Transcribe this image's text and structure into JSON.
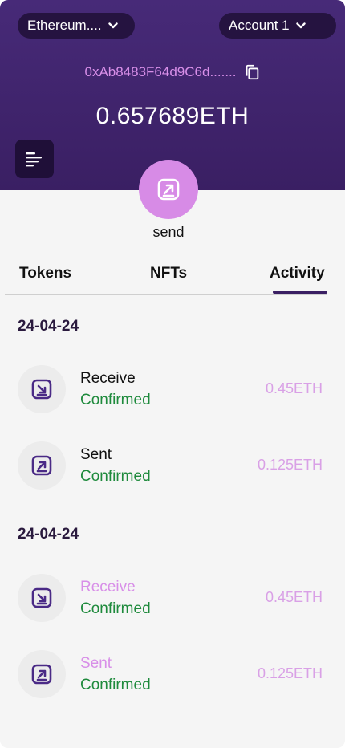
{
  "header": {
    "network_label": "Ethereum....",
    "account_label": "Account 1",
    "address": "0xAb8483F64d9C6d.......",
    "balance": "0.657689ETH"
  },
  "actions": {
    "send_label": "send"
  },
  "tabs": [
    {
      "label": "Tokens",
      "active": false
    },
    {
      "label": "NFTs",
      "active": false
    },
    {
      "label": "Activity",
      "active": true
    }
  ],
  "activity": {
    "groups": [
      {
        "date": "24-04-24",
        "items": [
          {
            "title": "Receive",
            "status": "Confirmed",
            "amount": "0.45ETH",
            "direction": "receive"
          },
          {
            "title": "Sent",
            "status": "Confirmed",
            "amount": "0.125ETH",
            "direction": "sent"
          }
        ]
      },
      {
        "date": "24-04-24",
        "items": [
          {
            "title": "Receive",
            "status": "Confirmed",
            "amount": "0.45ETH",
            "direction": "receive"
          },
          {
            "title": "Sent",
            "status": "Confirmed",
            "amount": "0.125ETH",
            "direction": "sent"
          }
        ]
      }
    ]
  },
  "colors": {
    "header_bg": "#472a78",
    "accent": "#d78be6",
    "confirmed": "#1e8a3c",
    "amount": "#d9a0e6"
  }
}
